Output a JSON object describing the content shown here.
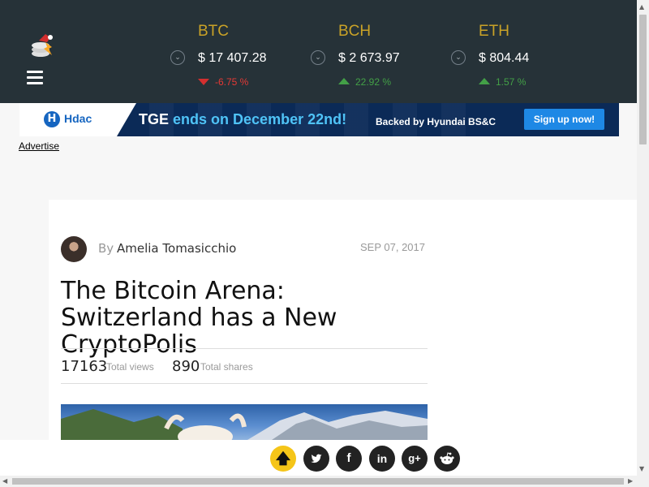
{
  "header": {
    "tickers": [
      {
        "symbol": "BTC",
        "price": "$ 17 407.28",
        "change": "-6.75 %",
        "direction": "down"
      },
      {
        "symbol": "BCH",
        "price": "$ 2 673.97",
        "change": "22.92 %",
        "direction": "up"
      },
      {
        "symbol": "ETH",
        "price": "$ 804.44",
        "change": "1.57 %",
        "direction": "up"
      }
    ]
  },
  "ad": {
    "brand": "Hdac",
    "message_part1": "TGE",
    "message_part2": "ends on December 22nd!",
    "sub": "Backed by Hyundai BS&C",
    "button": "Sign up now!",
    "advertise_link": "Advertise"
  },
  "article": {
    "by": "By",
    "author": "Amelia Tomasicchio",
    "date": "SEP 07, 2017",
    "title": "The Bitcoin Arena: Switzerland has a New CryptoPolis",
    "views": "17163",
    "views_label": "Total views",
    "shares": "890",
    "shares_label": "Total shares"
  },
  "colors": {
    "header_bg": "#263238",
    "symbol": "#c9a227",
    "negative": "#e53935",
    "positive": "#43a047",
    "up_button": "#f5c518"
  },
  "share_icons": [
    "arrow-up-icon",
    "twitter-icon",
    "facebook-icon",
    "linkedin-icon",
    "google-plus-icon",
    "reddit-icon"
  ]
}
